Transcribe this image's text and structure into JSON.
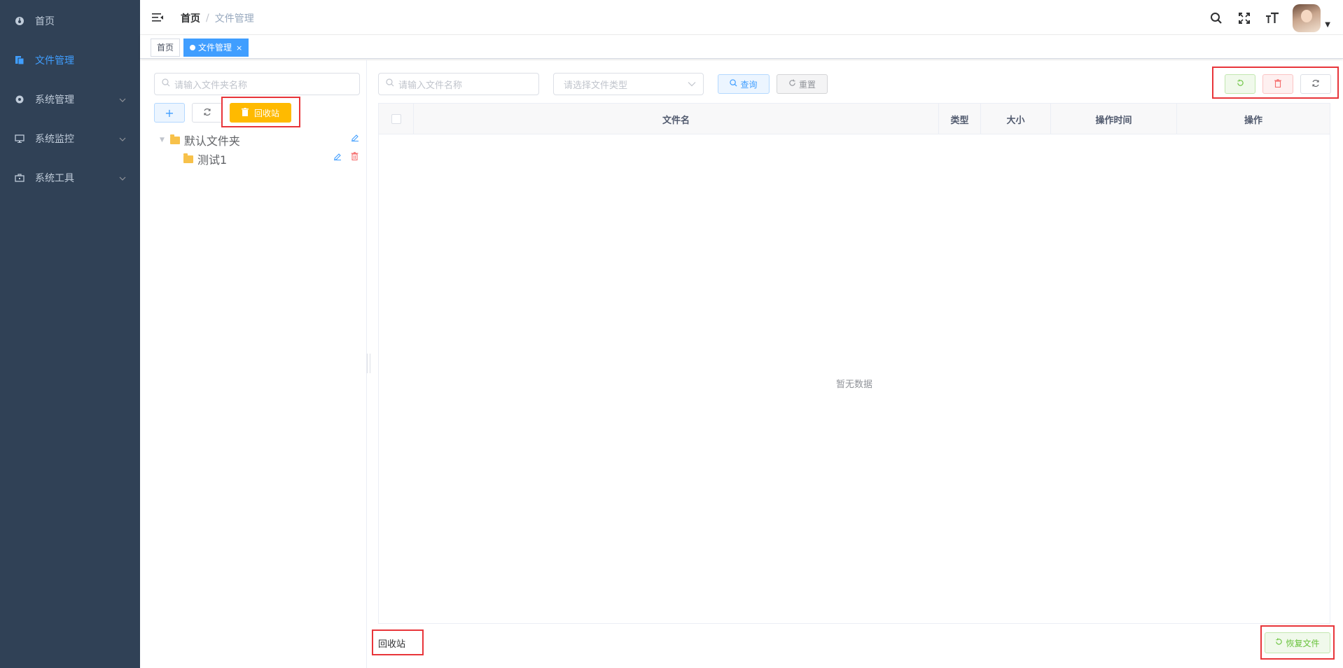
{
  "sidebar": {
    "items": [
      {
        "label": "首页",
        "icon": "dashboard-icon"
      },
      {
        "label": "文件管理",
        "icon": "file-icon",
        "active": true
      },
      {
        "label": "系统管理",
        "icon": "gear-icon"
      },
      {
        "label": "系统监控",
        "icon": "monitor-icon"
      },
      {
        "label": "系统工具",
        "icon": "toolbox-icon"
      }
    ],
    "bg_color": "#304156",
    "active_color": "#409eff"
  },
  "navbar": {
    "breadcrumb": {
      "home": "首页",
      "separator": "/",
      "current": "文件管理"
    },
    "icons": [
      "search-icon",
      "fullscreen-icon",
      "font-size-icon"
    ]
  },
  "tags": [
    {
      "label": "首页"
    },
    {
      "label": "文件管理",
      "active": true,
      "close": "×"
    }
  ],
  "folder_panel": {
    "search_placeholder": "请输入文件夹名称",
    "add_label": "+",
    "recycle_label": "回收站",
    "tree": [
      {
        "label": "默认文件夹"
      },
      {
        "label": "测试1"
      }
    ]
  },
  "file_panel": {
    "name_placeholder": "请输入文件名称",
    "type_placeholder": "请选择文件类型",
    "query_label": "查询",
    "reset_label": "重置",
    "columns": [
      "文件名",
      "类型",
      "大小",
      "操作时间",
      "操作"
    ],
    "empty_text": "暂无数据",
    "footer_label": "回收站",
    "restore_label": "恢复文件"
  },
  "colors": {
    "primary": "#409eff",
    "warning": "#ffba00",
    "success": "#67c23a",
    "danger": "#f56c6c",
    "highlight": "#e8353a"
  }
}
